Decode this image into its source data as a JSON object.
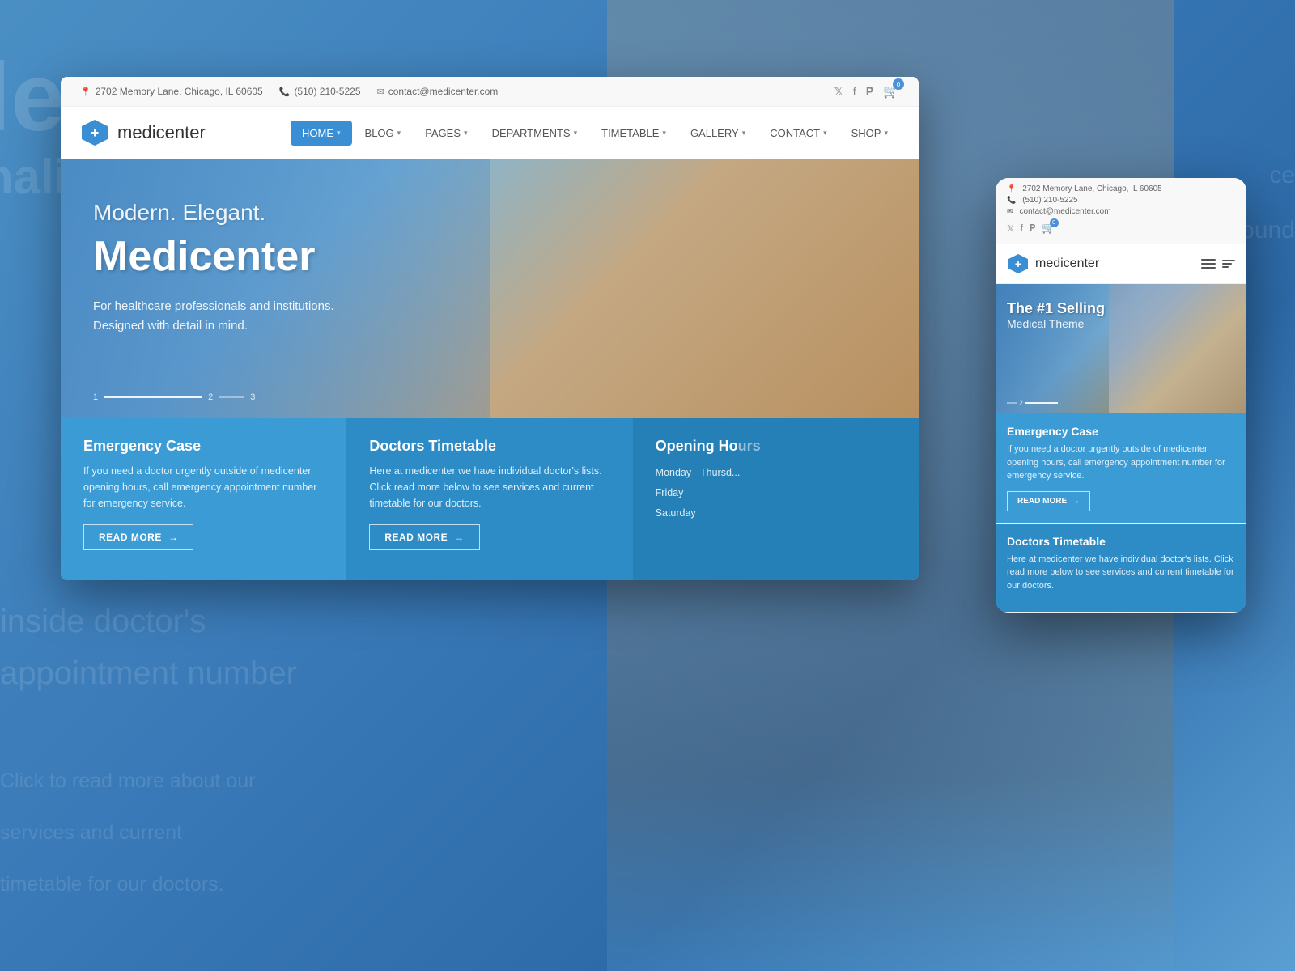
{
  "background": {
    "blur_text1": "le",
    "blur_text2": "nalis",
    "blur_text3": "inside doctor's\nappointment number",
    "blur_text4": "Click to read more about our\nservices and current\ntimetable for our doctors.",
    "blur_text_right1": "ce",
    "blur_text_right2": "ound"
  },
  "desktop": {
    "topbar": {
      "address": "2702 Memory Lane, Chicago, IL 60605",
      "phone": "(510) 210-5225",
      "email": "contact@medicenter.com",
      "social": {
        "twitter": "𝕏",
        "facebook": "f",
        "pinterest": "𝐏"
      },
      "cart_count": "0"
    },
    "nav": {
      "logo_text": "medicenter",
      "logo_plus": "+",
      "menu_items": [
        {
          "label": "HOME",
          "active": true,
          "has_dropdown": true
        },
        {
          "label": "BLOG",
          "active": false,
          "has_dropdown": true
        },
        {
          "label": "PAGES",
          "active": false,
          "has_dropdown": true
        },
        {
          "label": "DEPARTMENTS",
          "active": false,
          "has_dropdown": true
        },
        {
          "label": "TIMETABLE",
          "active": false,
          "has_dropdown": true
        },
        {
          "label": "GALLERY",
          "active": false,
          "has_dropdown": true
        },
        {
          "label": "CONTACT",
          "active": false,
          "has_dropdown": true
        },
        {
          "label": "SHOP",
          "active": false,
          "has_dropdown": true
        }
      ]
    },
    "hero": {
      "subtitle": "Modern. Elegant.",
      "title": "Medicenter",
      "description_line1": "For healthcare professionals and institutions.",
      "description_line2": "Designed with detail in mind.",
      "slide_nums": [
        "1",
        "2",
        "3"
      ]
    },
    "cards": [
      {
        "title": "Emergency Case",
        "text": "If you need a doctor urgently outside of medicenter opening hours, call emergency appointment number for emergency service.",
        "btn": "READ MORE",
        "btn_arrow": "→"
      },
      {
        "title": "Doctors Timetable",
        "text": "Here at medicenter we have individual doctor's lists. Click read more below to see services and current timetable for our doctors.",
        "btn": "READ MORE",
        "btn_arrow": "→"
      },
      {
        "title": "Opening Ho",
        "days": [
          "Monday - Thursd...",
          "Friday",
          "Saturday"
        ]
      }
    ]
  },
  "mobile": {
    "topbar": {
      "address": "2702 Memory Lane, Chicago, IL 60605",
      "phone": "(510) 210-5225",
      "email": "contact@medicenter.com",
      "cart_count": "0"
    },
    "nav": {
      "logo_text": "medicenter",
      "logo_plus": "+"
    },
    "hero": {
      "title_line1": "The #1 Selling",
      "title_line2": "Medical Theme",
      "slide_current": "2"
    },
    "cards": [
      {
        "title": "Emergency Case",
        "text": "If you need a doctor urgently outside of medicenter opening hours, call emergency appointment number for emergency service.",
        "btn": "READ MORE",
        "btn_arrow": "→"
      },
      {
        "title": "Doctors Timetable",
        "text": "Here at medicenter we have individual doctor's lists. Click read more below to see services and current timetable for our doctors.",
        "btn_label": ""
      }
    ]
  }
}
